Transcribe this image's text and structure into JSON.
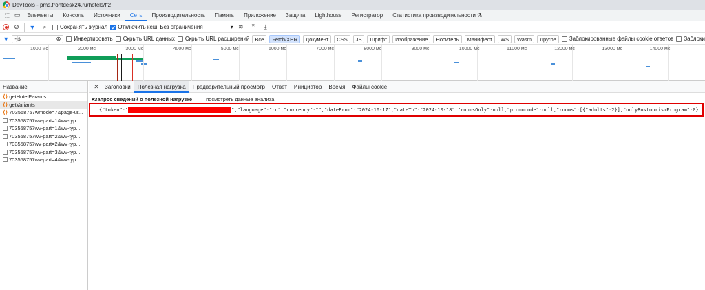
{
  "window": {
    "title": "DevTools - pms.frontdesk24.ru/hotels/ff2"
  },
  "tabs": [
    "Элементы",
    "Консоль",
    "Источники",
    "Сеть",
    "Производительность",
    "Память",
    "Приложение",
    "Защита",
    "Lighthouse",
    "Регистратор",
    "Статистика производительности ⚗"
  ],
  "toolbar": {
    "preserve_log": "Сохранять журнал",
    "disable_cache": "Отключить кеш",
    "throttling": "Без ограничения"
  },
  "filter": {
    "value": "-js",
    "invert": "Инвертировать",
    "hide_data_urls": "Скрыть URL данных",
    "hide_ext_urls": "Скрыть URL расширений",
    "types": [
      "Все",
      "Fetch/XHR",
      "Документ",
      "CSS",
      "JS",
      "Шрифт",
      "Изображение",
      "Носитель",
      "Манифест",
      "WS",
      "Wasm",
      "Другое"
    ],
    "blocked_cookies": "Заблокированные файлы cookie ответов",
    "blocked_more": "Заблоки"
  },
  "timeline": {
    "ticks": [
      "1000 мс",
      "2000 мс",
      "3000 мс",
      "4000 мс",
      "5000 мс",
      "6000 мс",
      "7000 мс",
      "8000 мс",
      "9000 мс",
      "10000 мс",
      "11000 мс",
      "12000 мс",
      "13000 мс",
      "14000 мс"
    ]
  },
  "requests": {
    "header": "Название",
    "items": [
      "getHotelParams",
      "getVariants",
      "703558757wmode=7&page-ur...",
      "703558757wv-part=1&wv-typ...",
      "703558757wv-part=1&wv-typ...",
      "703558757wv-part=2&wv-typ...",
      "703558757wv-part=2&wv-typ...",
      "703558757wv-part=3&wv-typ...",
      "703558757wv-part=4&wv-typ..."
    ]
  },
  "details": {
    "tabs": [
      "Заголовки",
      "Полезная нагрузка",
      "Предварительный просмотр",
      "Ответ",
      "Инициатор",
      "Время",
      "Файлы cookie"
    ],
    "payload_title": "▾Запрос сведений о полезной нагрузке",
    "view_parsed": "посмотреть данные анализа",
    "payload_start": "{\"token\":\"",
    "payload_rest": "\",\"language\":\"ru\",\"currency\":\"\",\"dateFrom\":\"2024-10-17\",\"dateTo\":\"2024-10-18\",\"roomsOnly\":null,\"promocode\":null,\"rooms\":[{\"adults\":2}],\"onlyRostourismProgram\":0}"
  }
}
